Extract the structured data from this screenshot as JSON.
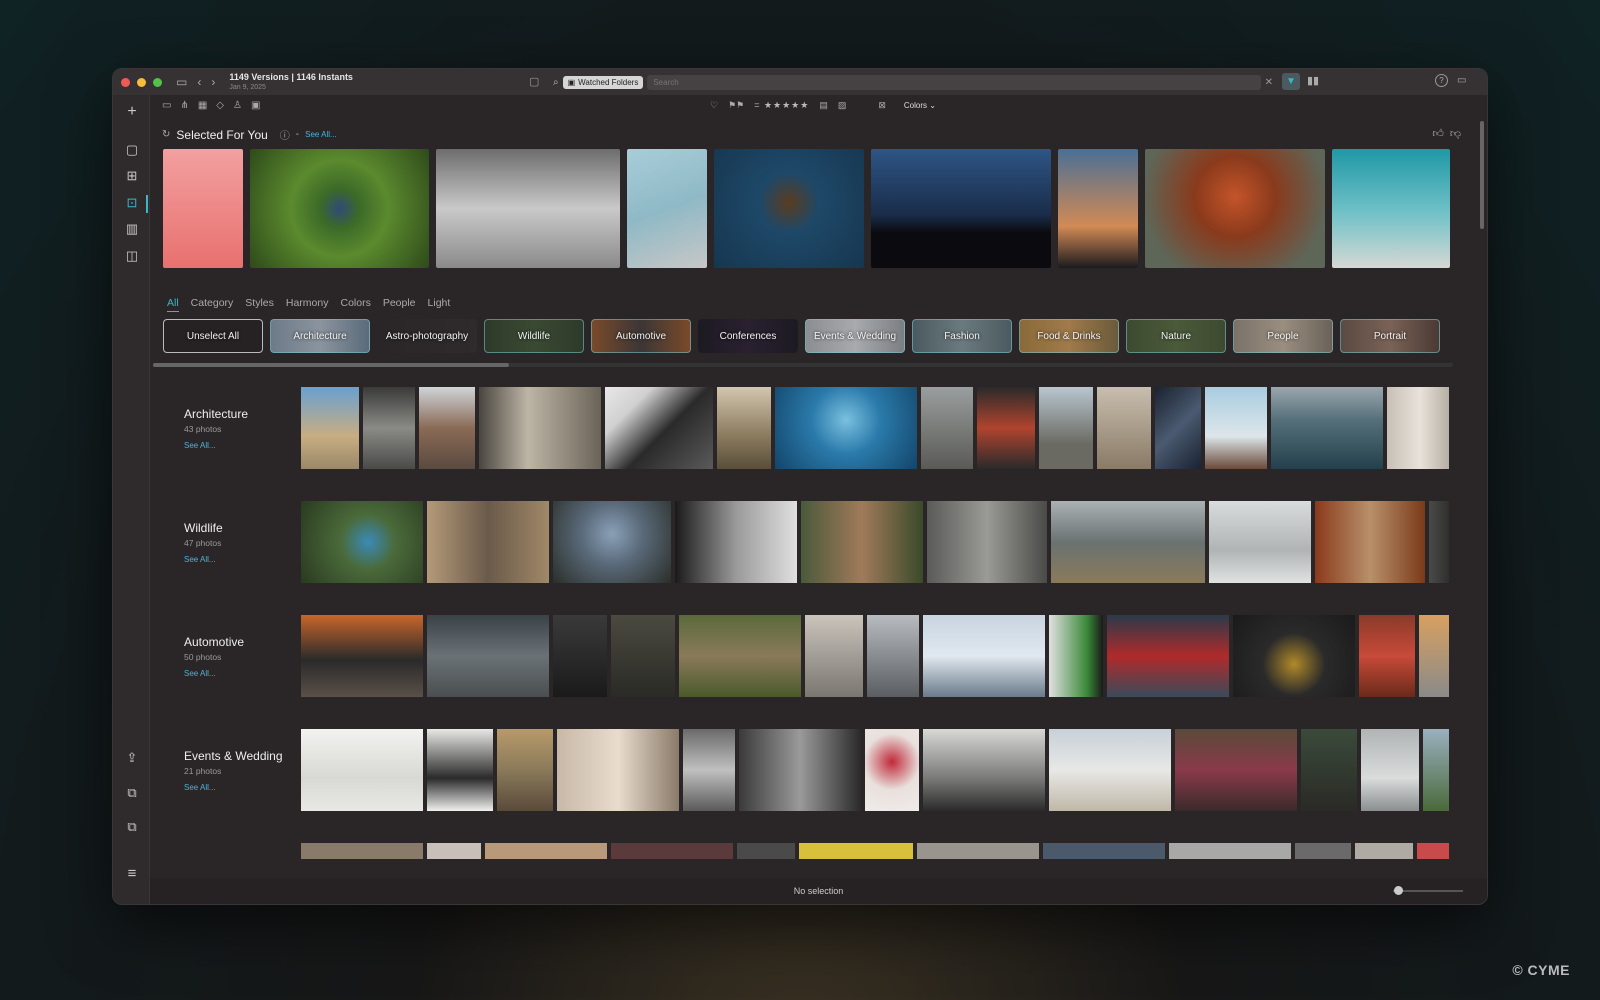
{
  "window": {
    "title": "1149 Versions | 1146 Instants",
    "date": "Jan 9, 2025"
  },
  "search": {
    "scope_chip": "Watched Folders",
    "placeholder": "Search"
  },
  "toolbar": {
    "stars": "= ★★★★★",
    "colors_label": "Colors ⌄"
  },
  "selected_for_you": {
    "title": "Selected For You",
    "see_all": "See All..."
  },
  "tabs": [
    {
      "label": "All",
      "active": true
    },
    {
      "label": "Category"
    },
    {
      "label": "Styles"
    },
    {
      "label": "Harmony"
    },
    {
      "label": "Colors"
    },
    {
      "label": "People"
    },
    {
      "label": "Light"
    }
  ],
  "chips": [
    {
      "label": "Unselect All"
    },
    {
      "label": "Architecture"
    },
    {
      "label": "Astro-photography"
    },
    {
      "label": "Wildlife"
    },
    {
      "label": "Automotive"
    },
    {
      "label": "Conferences"
    },
    {
      "label": "Events & Wedding"
    },
    {
      "label": "Fashion"
    },
    {
      "label": "Food & Drinks"
    },
    {
      "label": "Nature"
    },
    {
      "label": "People"
    },
    {
      "label": "Portrait"
    }
  ],
  "sections": [
    {
      "title": "Architecture",
      "count": "43 photos",
      "see_all": "See All..."
    },
    {
      "title": "Wildlife",
      "count": "47 photos",
      "see_all": "See All..."
    },
    {
      "title": "Automotive",
      "count": "50 photos",
      "see_all": "See All..."
    },
    {
      "title": "Events & Wedding",
      "count": "21 photos",
      "see_all": "See All..."
    }
  ],
  "status": {
    "text": "No selection"
  },
  "colors": {
    "accent": "#3ab6c8",
    "link": "#4ab4d8"
  },
  "copyright": "© CYME"
}
